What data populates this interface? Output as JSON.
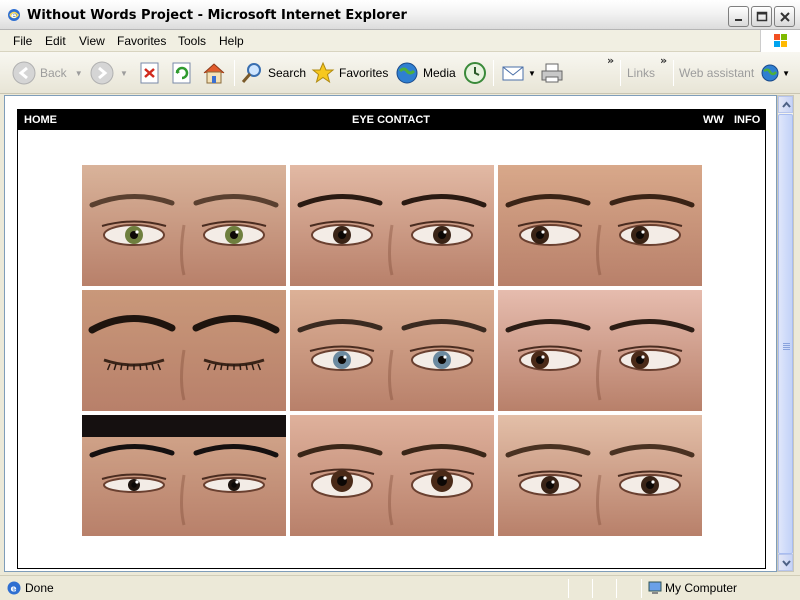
{
  "window": {
    "title": "Without Words Project - Microsoft Internet Explorer"
  },
  "menu": {
    "items": [
      "File",
      "Edit",
      "View",
      "Favorites",
      "Tools",
      "Help"
    ]
  },
  "toolbar": {
    "back_label": "Back",
    "search_label": "Search",
    "favorites_label": "Favorites",
    "media_label": "Media",
    "links_label": "Links",
    "assistant_label": "Web assistant"
  },
  "site": {
    "nav_home": "HOME",
    "nav_title": "EYE CONTACT",
    "nav_ww": "WW",
    "nav_info": "INFO",
    "photos": [
      {
        "name": "eyes-photo-1",
        "skin": "#d9b39a",
        "iris": "#6f7f3e",
        "brow": "#5a4030",
        "state": "open"
      },
      {
        "name": "eyes-photo-2",
        "skin": "#e2b9a4",
        "iris": "#3a2417",
        "brow": "#2a1a12",
        "state": "open"
      },
      {
        "name": "eyes-photo-3",
        "skin": "#d8a88a",
        "iris": "#3b2416",
        "brow": "#3b2416",
        "state": "side"
      },
      {
        "name": "eyes-photo-4",
        "skin": "#c9987a",
        "iris": "#2a1a12",
        "brow": "#1e140e",
        "state": "closed"
      },
      {
        "name": "eyes-photo-5",
        "skin": "#dcb197",
        "iris": "#6c8aa0",
        "brow": "#3a2a20",
        "state": "open"
      },
      {
        "name": "eyes-photo-6",
        "skin": "#e6bcae",
        "iris": "#4a2a18",
        "brow": "#2c1d15",
        "state": "side"
      },
      {
        "name": "eyes-photo-7",
        "skin": "#d4a98e",
        "iris": "#1e140e",
        "brow": "#151010",
        "state": "narrow"
      },
      {
        "name": "eyes-photo-8",
        "skin": "#dfb19c",
        "iris": "#4a2a18",
        "brow": "#3a2618",
        "state": "up"
      },
      {
        "name": "eyes-photo-9",
        "skin": "#e3bfa8",
        "iris": "#3a2417",
        "brow": "#4a3222",
        "state": "open"
      }
    ]
  },
  "status": {
    "text": "Done",
    "zone": "My Computer"
  },
  "colors": {
    "nav_bg": "#000000",
    "nav_fg": "#ffffff"
  }
}
